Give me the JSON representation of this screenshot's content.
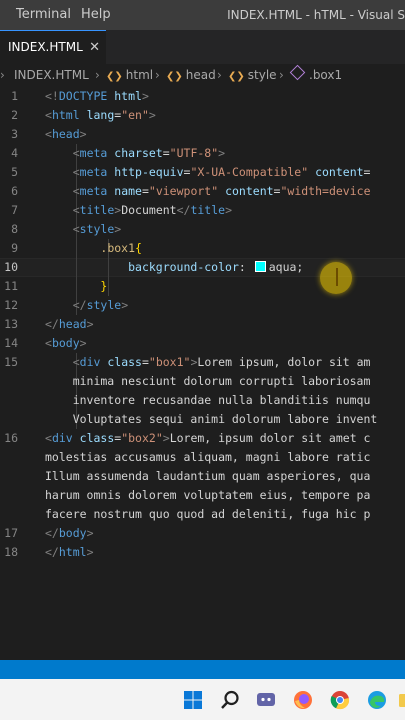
{
  "menubar": {
    "items": [
      "Terminal",
      "Help"
    ],
    "window_title": "INDEX.HTML - hTML - Visual S"
  },
  "tab": {
    "label": "INDEX.HTML",
    "close": "✕"
  },
  "breadcrumb": [
    "INDEX.HTML",
    "html",
    "head",
    "style",
    ".box1"
  ],
  "editor": {
    "active_line": 10,
    "lines": [
      {
        "n": "1",
        "segs": [
          [
            "p",
            "<!"
          ],
          [
            "t",
            "DOCTYPE"
          ],
          [
            "a",
            " html"
          ],
          [
            "p",
            ">"
          ]
        ]
      },
      {
        "n": "2",
        "segs": [
          [
            "p",
            "<"
          ],
          [
            "t",
            "html"
          ],
          [
            "a",
            " lang"
          ],
          [
            "x",
            "="
          ],
          [
            "v",
            "\"en\""
          ],
          [
            "p",
            ">"
          ]
        ]
      },
      {
        "n": "3",
        "segs": [
          [
            "p",
            "<"
          ],
          [
            "t",
            "head"
          ],
          [
            "p",
            ">"
          ]
        ]
      },
      {
        "n": "4",
        "segs": [
          [
            "x",
            "    "
          ],
          [
            "p",
            "<"
          ],
          [
            "t",
            "meta"
          ],
          [
            "a",
            " charset"
          ],
          [
            "x",
            "="
          ],
          [
            "v",
            "\"UTF-8\""
          ],
          [
            "p",
            ">"
          ]
        ]
      },
      {
        "n": "5",
        "segs": [
          [
            "x",
            "    "
          ],
          [
            "p",
            "<"
          ],
          [
            "t",
            "meta"
          ],
          [
            "a",
            " http-equiv"
          ],
          [
            "x",
            "="
          ],
          [
            "v",
            "\"X-UA-Compatible\""
          ],
          [
            "a",
            " content"
          ],
          [
            "x",
            "="
          ]
        ]
      },
      {
        "n": "6",
        "segs": [
          [
            "x",
            "    "
          ],
          [
            "p",
            "<"
          ],
          [
            "t",
            "meta"
          ],
          [
            "a",
            " name"
          ],
          [
            "x",
            "="
          ],
          [
            "v",
            "\"viewport\""
          ],
          [
            "a",
            " content"
          ],
          [
            "x",
            "="
          ],
          [
            "v",
            "\"width=device"
          ]
        ]
      },
      {
        "n": "7",
        "segs": [
          [
            "x",
            "    "
          ],
          [
            "p",
            "<"
          ],
          [
            "t",
            "title"
          ],
          [
            "p",
            ">"
          ],
          [
            "x",
            "Document"
          ],
          [
            "p",
            "</"
          ],
          [
            "t",
            "title"
          ],
          [
            "p",
            ">"
          ]
        ]
      },
      {
        "n": "8",
        "segs": [
          [
            "x",
            "    "
          ],
          [
            "p",
            "<"
          ],
          [
            "t",
            "style"
          ],
          [
            "p",
            ">"
          ]
        ]
      },
      {
        "n": "9",
        "segs": [
          [
            "x",
            "        "
          ],
          [
            "s",
            ".box1"
          ],
          [
            "b",
            "{"
          ]
        ]
      },
      {
        "n": "10",
        "segs": [
          [
            "x",
            "            "
          ],
          [
            "r",
            "background-color"
          ],
          [
            "x",
            ": "
          ],
          [
            "w",
            ""
          ],
          [
            "x",
            "aqua;"
          ]
        ]
      },
      {
        "n": "11",
        "segs": [
          [
            "x",
            "        "
          ],
          [
            "b",
            "}"
          ]
        ]
      },
      {
        "n": "12",
        "segs": [
          [
            "x",
            "    "
          ],
          [
            "p",
            "</"
          ],
          [
            "t",
            "style"
          ],
          [
            "p",
            ">"
          ]
        ]
      },
      {
        "n": "13",
        "segs": [
          [
            "p",
            "</"
          ],
          [
            "t",
            "head"
          ],
          [
            "p",
            ">"
          ]
        ]
      },
      {
        "n": "14",
        "segs": [
          [
            "p",
            "<"
          ],
          [
            "t",
            "body"
          ],
          [
            "p",
            ">"
          ]
        ]
      },
      {
        "n": "15",
        "segs": [
          [
            "x",
            "    "
          ],
          [
            "p",
            "<"
          ],
          [
            "t",
            "div"
          ],
          [
            "a",
            " class"
          ],
          [
            "x",
            "="
          ],
          [
            "v",
            "\"box1\""
          ],
          [
            "p",
            ">"
          ],
          [
            "x",
            "Lorem ipsum, dolor sit am"
          ]
        ]
      },
      {
        "n": "",
        "segs": [
          [
            "x",
            "    minima nesciunt dolorum corrupti laboriosam"
          ]
        ]
      },
      {
        "n": "",
        "segs": [
          [
            "x",
            "    inventore recusandae nulla blanditiis numqu"
          ]
        ]
      },
      {
        "n": "",
        "segs": [
          [
            "x",
            "    Voluptates sequi animi dolorum labore invent"
          ]
        ]
      },
      {
        "n": "16",
        "segs": [
          [
            "p",
            "<"
          ],
          [
            "t",
            "div"
          ],
          [
            "a",
            " class"
          ],
          [
            "x",
            "="
          ],
          [
            "v",
            "\"box2\""
          ],
          [
            "p",
            ">"
          ],
          [
            "x",
            "Lorem, ipsum dolor sit amet c"
          ]
        ]
      },
      {
        "n": "",
        "segs": [
          [
            "x",
            "molestias accusamus aliquam, magni labore ratic"
          ]
        ]
      },
      {
        "n": "",
        "segs": [
          [
            "x",
            "Illum assumenda laudantium quam asperiores, qua"
          ]
        ]
      },
      {
        "n": "",
        "segs": [
          [
            "x",
            "harum omnis dolorem voluptatem eius, tempore pa"
          ]
        ]
      },
      {
        "n": "",
        "segs": [
          [
            "x",
            "facere nostrum quo quod ad deleniti, fuga hic p"
          ]
        ]
      },
      {
        "n": "17",
        "segs": [
          [
            "p",
            "</"
          ],
          [
            "t",
            "body"
          ],
          [
            "p",
            ">"
          ]
        ]
      },
      {
        "n": "18",
        "segs": [
          [
            "p",
            "</"
          ],
          [
            "t",
            "html"
          ],
          [
            "p",
            ">"
          ]
        ]
      }
    ]
  },
  "colors": {
    "swatch": "#00ffff",
    "accent": "#007acc"
  },
  "taskbar": {
    "icons": [
      "windows-start-icon",
      "search-icon",
      "teams-chat-icon",
      "firefox-icon",
      "chrome-icon",
      "edge-icon",
      "folder-icon"
    ]
  }
}
